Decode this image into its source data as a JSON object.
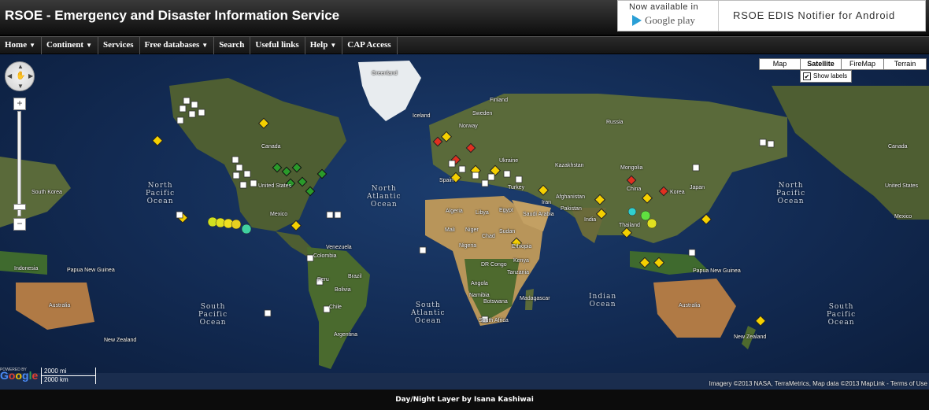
{
  "header": {
    "title": "RSOE - Emergency and Disaster Information Service"
  },
  "promo": {
    "available": "Now available in",
    "store": "Google play",
    "app": "RSOE EDIS Notifier for Android"
  },
  "nav": [
    {
      "label": "Home",
      "dropdown": true
    },
    {
      "label": "Continent",
      "dropdown": true
    },
    {
      "label": "Services",
      "dropdown": false
    },
    {
      "label": "Free databases",
      "dropdown": true
    },
    {
      "label": "Search",
      "dropdown": false
    },
    {
      "label": "Useful links",
      "dropdown": false
    },
    {
      "label": "Help",
      "dropdown": true
    },
    {
      "label": "CAP Access",
      "dropdown": false
    }
  ],
  "maptypes": [
    {
      "label": "Map",
      "selected": false
    },
    {
      "label": "Satellite",
      "selected": true
    },
    {
      "label": "FireMap",
      "selected": false
    },
    {
      "label": "Terrain",
      "selected": false
    }
  ],
  "show_labels": {
    "label": "Show labels",
    "checked": true
  },
  "zoom": {
    "in": "+",
    "out": "−"
  },
  "oceans": [
    {
      "text": "North\nPacific\nOcean"
    },
    {
      "text": "North\nAtlantic\nOcean"
    },
    {
      "text": "North\nPacific\nOcean"
    },
    {
      "text": "South\nPacific\nOcean"
    },
    {
      "text": "South\nAtlantic\nOcean"
    },
    {
      "text": "Indian\nOcean"
    },
    {
      "text": "South\nPacific\nOcean"
    }
  ],
  "places": [
    "Greenland",
    "Iceland",
    "Finland",
    "Sweden",
    "Norway",
    "Russia",
    "Canada",
    "Ukraine",
    "Kazakhstan",
    "Mongolia",
    "China",
    "Japan",
    "South Korea",
    "Korea",
    "Spain",
    "Turkey",
    "Afghanistan",
    "Iran",
    "Pakistan",
    "India",
    "Thailand",
    "Algeria",
    "Libya",
    "Egypt",
    "Saudi Arabia",
    "Mali",
    "Niger",
    "Chad",
    "Sudan",
    "Nigeria",
    "Ethiopia",
    "Kenya",
    "DR Congo",
    "Tanzania",
    "Angola",
    "Namibia",
    "Botswana",
    "Madagascar",
    "South Africa",
    "Venezuela",
    "Colombia",
    "Peru",
    "Brazil",
    "Bolivia",
    "Chile",
    "Argentina",
    "Indonesia",
    "Papua New Guinea",
    "Australia",
    "New Zealand",
    "United States",
    "Mexico",
    "Mongolia",
    "China",
    "Papua New Guinea",
    "Australia",
    "New Zealand",
    "Canada",
    "United States",
    "Mexico"
  ],
  "scale": {
    "miles": "2000 mi",
    "km": "2000 km"
  },
  "powered": "POWERED BY",
  "google": "Google",
  "attribution": "Imagery ©2013 NASA, TerraMetrics, Map data ©2013 MapLink - Terms of Use",
  "footer": "Day/Night Layer by Isana Kashiwai",
  "colors": {
    "land": "#5a6a3a",
    "ocean": "#14305e",
    "desert": "#b8955a",
    "warning": "#f5d000",
    "alert": "#e03020",
    "green": "#2a9a2a"
  },
  "markers": [
    {
      "type": "warning-icon"
    },
    {
      "type": "alert-icon"
    },
    {
      "type": "green-icon"
    },
    {
      "type": "cyclone-icon"
    },
    {
      "type": "info-icon"
    }
  ]
}
